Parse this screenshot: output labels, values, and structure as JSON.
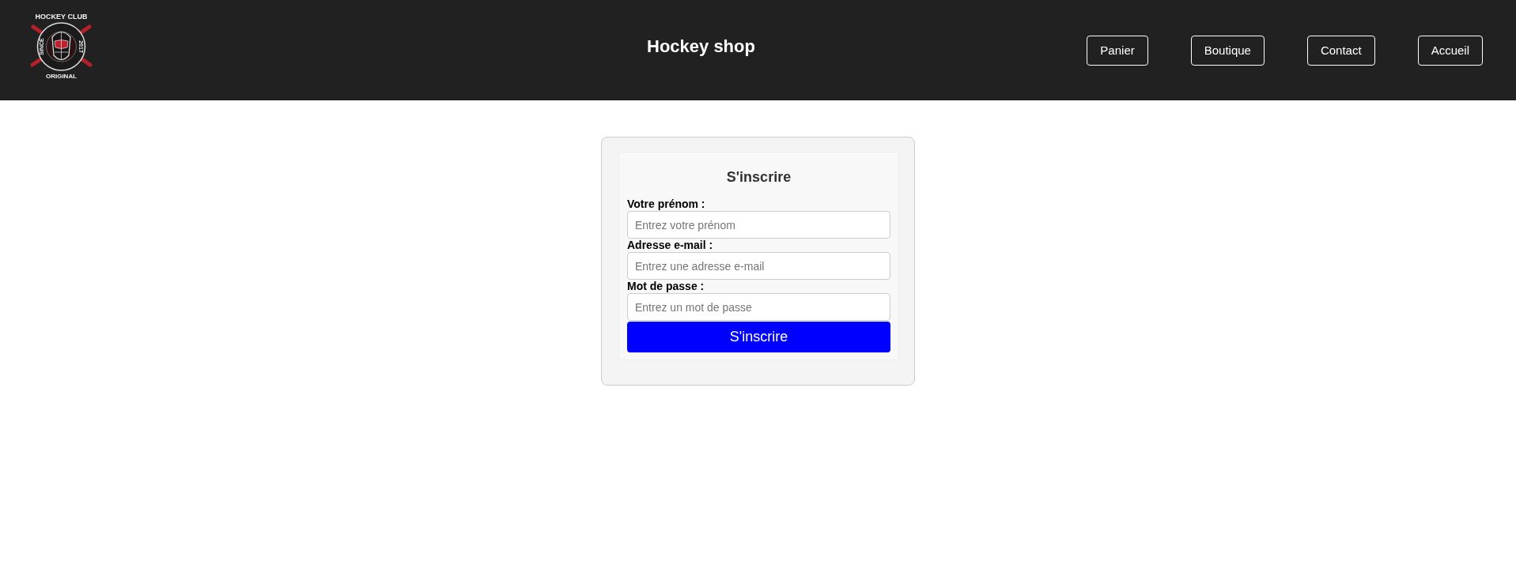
{
  "header": {
    "logo": {
      "top_text": "HOCKEY CLUB",
      "left_text": "SINCE",
      "right_text": "2017",
      "bottom_text": "ORIGINAL"
    },
    "title": "Hockey shop",
    "nav": [
      {
        "label": "Panier"
      },
      {
        "label": "Boutique"
      },
      {
        "label": "Contact"
      },
      {
        "label": "Accueil"
      }
    ]
  },
  "form": {
    "title": "S'inscrire",
    "fields": [
      {
        "label": "Votre prénom :",
        "placeholder": "Entrez votre prénom"
      },
      {
        "label": "Adresse e-mail :",
        "placeholder": "Entrez une adresse e-mail"
      },
      {
        "label": "Mot de passe :",
        "placeholder": "Entrez un mot de passe"
      }
    ],
    "submit": "S'inscrire"
  }
}
